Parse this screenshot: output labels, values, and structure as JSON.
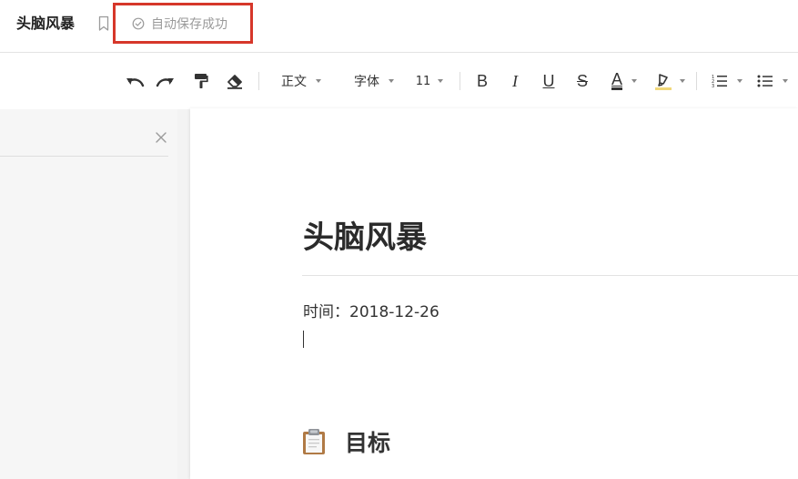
{
  "header": {
    "doc_title": "头脑风暴",
    "save_status": "自动保存成功",
    "icons": {
      "bookmark": "bookmark-icon",
      "status": "check-circle-icon"
    }
  },
  "toolbar": {
    "style_label": "正文",
    "font_label": "字体",
    "size_label": "11",
    "bold": "B",
    "italic": "I",
    "underline": "U",
    "strike": "S",
    "font_color": "A",
    "icons": [
      "undo-icon",
      "redo-icon",
      "format-painter-icon",
      "eraser-icon",
      "highlight-icon",
      "ordered-list-icon",
      "bullet-list-icon"
    ],
    "colors": {
      "font_color": "#333333",
      "highlight": "#f1d87a"
    }
  },
  "document": {
    "title": "头脑风暴",
    "date_line": "时间：2018-12-26",
    "section_title": "目标",
    "section_icon": "clipboard-icon"
  },
  "accent": {
    "save_highlight_border": "#d6372a"
  }
}
